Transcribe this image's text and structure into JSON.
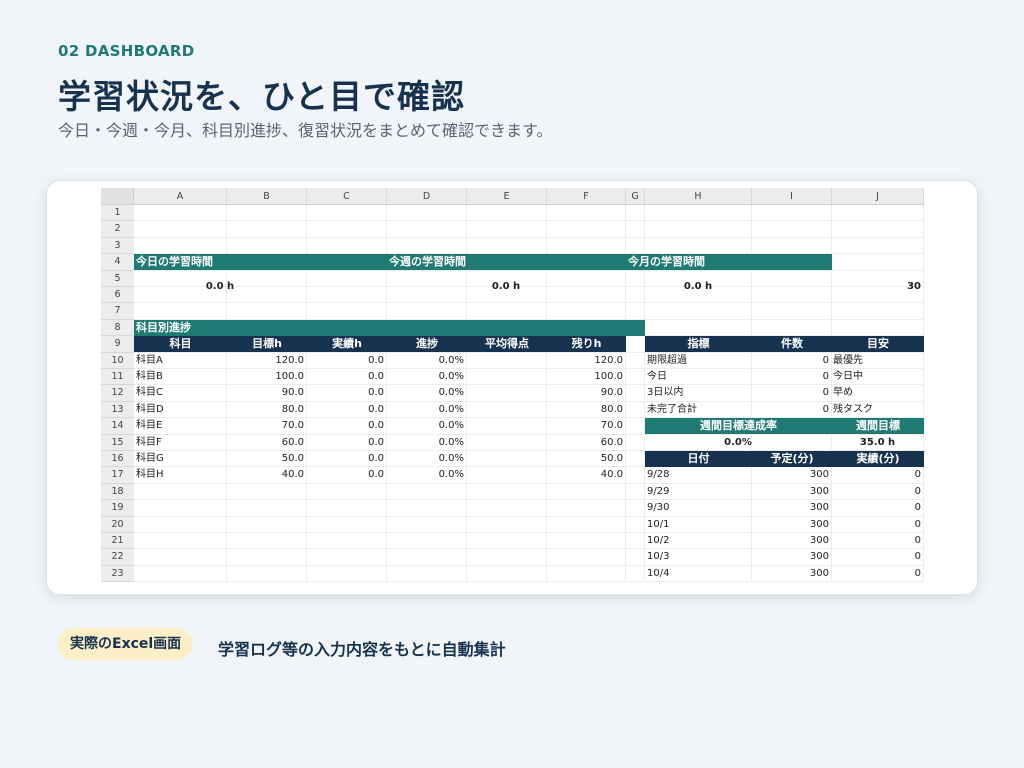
{
  "header": {
    "tag": "02  DASHBOARD",
    "title": "学習状況を、ひと目で確認",
    "subtitle": "今日・今週・今月、科目別進捗、復習状況をまとめて確認できます。"
  },
  "sheet": {
    "columns": [
      "A",
      "B",
      "C",
      "D",
      "E",
      "F",
      "G",
      "H",
      "I",
      "J"
    ],
    "rows": [
      "1",
      "2",
      "3",
      "4",
      "5",
      "6",
      "7",
      "8",
      "9",
      "10",
      "11",
      "12",
      "13",
      "14",
      "15",
      "16",
      "17",
      "18",
      "19",
      "20",
      "21",
      "22",
      "23"
    ],
    "summary": {
      "today_label": "今日の学習時間",
      "week_label": "今週の学習時間",
      "month_label": "今月の学習時間",
      "today_value": "0.0 h",
      "week_value": "0.0 h",
      "month_value": "0.0 h",
      "month_extra": "30"
    },
    "subject_section_title": "科目別進捗",
    "subject_headers": [
      "科目",
      "目標h",
      "実績h",
      "進捗",
      "平均得点",
      "残りh"
    ],
    "subjects": [
      {
        "name": "科目A",
        "target": "120.0",
        "actual": "0.0",
        "progress": "0.0%",
        "avg": "",
        "remaining": "120.0"
      },
      {
        "name": "科目B",
        "target": "100.0",
        "actual": "0.0",
        "progress": "0.0%",
        "avg": "",
        "remaining": "100.0"
      },
      {
        "name": "科目C",
        "target": "90.0",
        "actual": "0.0",
        "progress": "0.0%",
        "avg": "",
        "remaining": "90.0"
      },
      {
        "name": "科目D",
        "target": "80.0",
        "actual": "0.0",
        "progress": "0.0%",
        "avg": "",
        "remaining": "80.0"
      },
      {
        "name": "科目E",
        "target": "70.0",
        "actual": "0.0",
        "progress": "0.0%",
        "avg": "",
        "remaining": "70.0"
      },
      {
        "name": "科目F",
        "target": "60.0",
        "actual": "0.0",
        "progress": "0.0%",
        "avg": "",
        "remaining": "60.0"
      },
      {
        "name": "科目G",
        "target": "50.0",
        "actual": "0.0",
        "progress": "0.0%",
        "avg": "",
        "remaining": "50.0"
      },
      {
        "name": "科目H",
        "target": "40.0",
        "actual": "0.0",
        "progress": "0.0%",
        "avg": "",
        "remaining": "40.0"
      }
    ],
    "indicator_headers": [
      "指標",
      "件数",
      "目安"
    ],
    "indicators": [
      {
        "name": "期限超過",
        "count": "0",
        "guide": "最優先"
      },
      {
        "name": "今日",
        "count": "0",
        "guide": "今日中"
      },
      {
        "name": "3日以内",
        "count": "0",
        "guide": "早め"
      },
      {
        "name": "未完了合計",
        "count": "0",
        "guide": "残タスク"
      }
    ],
    "weekly": {
      "rate_label": "週間目標達成率",
      "goal_label": "週間目標",
      "rate_value": "0.0%",
      "goal_value": "35.0 h"
    },
    "daily_headers": [
      "日付",
      "予定(分)",
      "実績(分)"
    ],
    "daily": [
      {
        "date": "9/28",
        "plan": "300",
        "actual": "0"
      },
      {
        "date": "9/29",
        "plan": "300",
        "actual": "0"
      },
      {
        "date": "9/30",
        "plan": "300",
        "actual": "0"
      },
      {
        "date": "10/1",
        "plan": "300",
        "actual": "0"
      },
      {
        "date": "10/2",
        "plan": "300",
        "actual": "0"
      },
      {
        "date": "10/3",
        "plan": "300",
        "actual": "0"
      },
      {
        "date": "10/4",
        "plan": "300",
        "actual": "0"
      }
    ]
  },
  "footer": {
    "badge": "実際のExcel画面",
    "caption": "学習ログ等の入力内容をもとに自動集計"
  },
  "colors": {
    "teal": "#1f7a74",
    "navy": "#17324f",
    "badge_bg": "#fcefc7",
    "background": "#f1f5f9"
  }
}
